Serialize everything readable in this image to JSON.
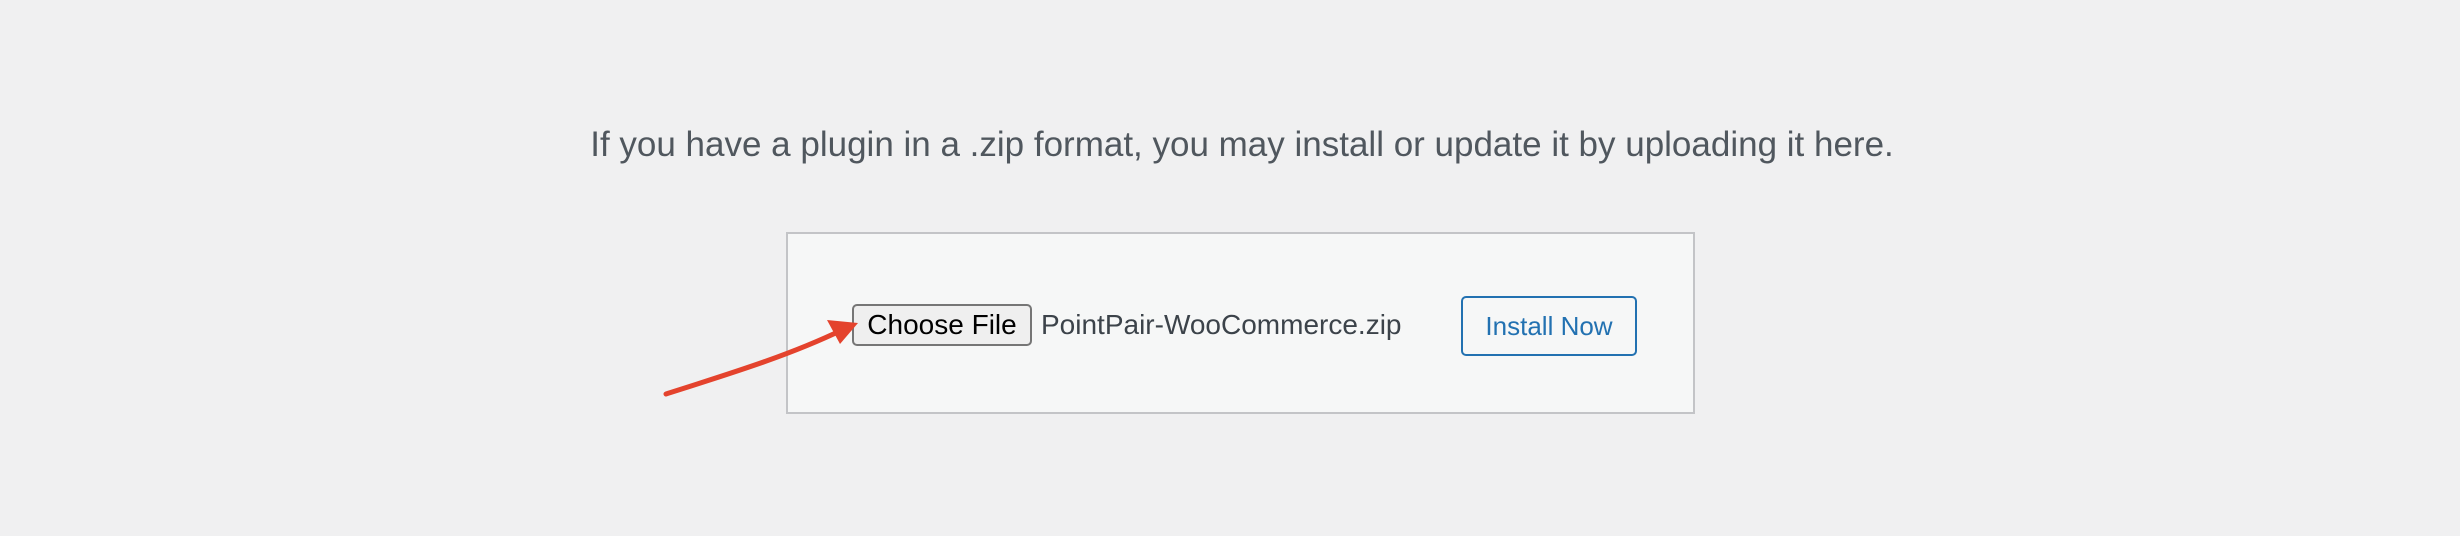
{
  "help_text": "If you have a plugin in a .zip format, you may install or update it by uploading it here.",
  "upload_form": {
    "choose_file_label": "Choose File",
    "file_name": "PointPair-WooCommerce.zip",
    "install_label": "Install Now"
  },
  "annotation": {
    "icon": "arrow-icon",
    "color": "#e4432d"
  },
  "colors": {
    "background": "#f0f0f1",
    "box_background": "#f6f7f7",
    "accent": "#2271b1"
  }
}
